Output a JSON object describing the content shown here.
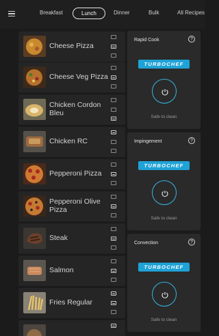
{
  "nav": {
    "tabs": [
      {
        "label": "Breakfast"
      },
      {
        "label": "Lunch"
      },
      {
        "label": "Dinner"
      },
      {
        "label": "Bulk"
      },
      {
        "label": "All Recipes"
      }
    ],
    "active_tab": "Lunch"
  },
  "recipes": [
    {
      "name": "Cheese Pizza"
    },
    {
      "name": "Cheese Veg Pizza"
    },
    {
      "name": "Chicken Cordon Bleu"
    },
    {
      "name": "Chicken RC"
    },
    {
      "name": "Pepperoni Pizza"
    },
    {
      "name": "Pepperoni Olive Pizza"
    },
    {
      "name": "Steak"
    },
    {
      "name": "Salmon"
    },
    {
      "name": "Fries Regular"
    }
  ],
  "ovens": [
    {
      "title": "Rapid Cook",
      "brand": "TURBOCHEF",
      "status": "Safe to clean"
    },
    {
      "title": "Impingement",
      "brand": "TURBOCHEF",
      "status": "Safe to clean"
    },
    {
      "title": "Convection",
      "brand": "TURBOCHEF",
      "status": "Safe to clean"
    }
  ],
  "colors": {
    "background": "#1b1b1b",
    "card": "#2a2a2a",
    "row": "#252525",
    "accent": "#37b7e6",
    "brand": "#1fa2d6"
  },
  "icons": {
    "menu": "hamburger-menu-icon",
    "help": "question-circle-icon",
    "power": "power-icon"
  }
}
